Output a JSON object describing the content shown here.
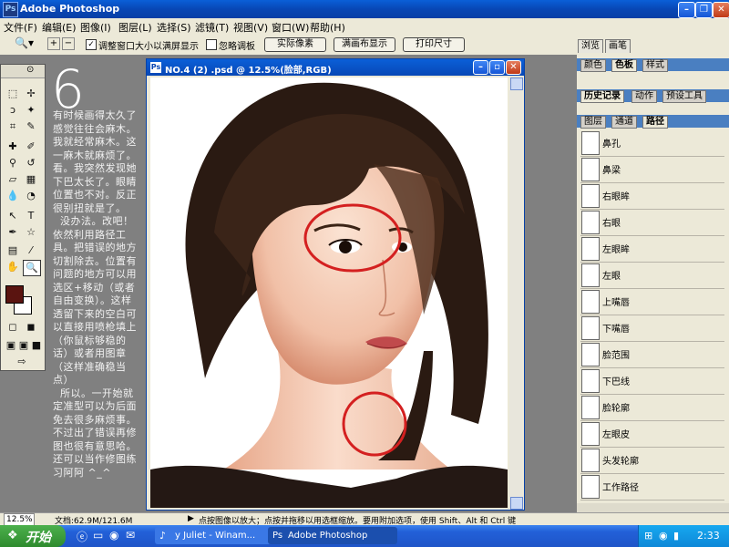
{
  "app": {
    "title": "Adobe Photoshop"
  },
  "menu": [
    "文件(F)",
    "编辑(E)",
    "图像(I)",
    "图层(L)",
    "选择(S)",
    "滤镜(T)",
    "视图(V)",
    "窗口(W)",
    "帮助(H)"
  ],
  "options": {
    "resize_window_label": "调整窗口大小以满屏显示",
    "ignore_palettes_label": "忽略调板",
    "actual_pixels": "实际像素",
    "fit_on_screen": "满画布显示",
    "print_size": "打印尺寸",
    "resize_checked": "✓"
  },
  "palette_well": {
    "tab1": "浏览",
    "tab2": "画笔"
  },
  "tutorial": {
    "step_number": "6",
    "paragraph1": "有时候画得太久了感觉往往会麻木。我就经常麻木。这一麻木就麻烦了。看。我突然发现她下巴太长了。眼睛位置也不对。反正很别扭就是了。",
    "paragraph2": "  没办法。改吧！依然利用路径工具。把错误的地方切割除去。位置有问题的地方可以用选区+移动（或者自由变换）。这样透留下来的空白可以直接用喷枪填上（你鼠标够稳的话）或者用图章（这样准确稳当点）",
    "paragraph3": "  所以。一开始就定准型可以为后面免去很多麻烦事。不过出了错误再修图也很有意思哈。还可以当作修图练习阿阿 ^_^"
  },
  "document": {
    "title": "NO.4 (2) .psd @ 12.5%(脸部,RGB)"
  },
  "panels": {
    "group1": [
      "颜色",
      "色板",
      "样式"
    ],
    "group2": [
      "历史记录",
      "动作",
      "预设工具"
    ],
    "group3": [
      "图层",
      "通道",
      "路径"
    ]
  },
  "paths": [
    "鼻孔",
    "鼻梁",
    "右眼眸",
    "右眼",
    "左眼眸",
    "左眼",
    "上嘴唇",
    "下嘴唇",
    "脸范围",
    "下巴线",
    "脸轮廓",
    "左眼皮",
    "头发轮廓",
    "工作路径"
  ],
  "status": {
    "zoom": "12.5%",
    "doc_info": "文档:62.9M/121.6M",
    "hint": "点按图像以放大；点按并拖移以用选框缩放。要用附加选项，使用 Shift、Alt 和 Ctrl 键"
  },
  "taskbar": {
    "start": "开始",
    "item1": "y Juliet - Winam...",
    "item2": "Adobe Photoshop",
    "clock": "2:33"
  },
  "colors": {
    "foreground": "#5a1410",
    "background": "#ffffff",
    "annotation": "#d42020"
  }
}
